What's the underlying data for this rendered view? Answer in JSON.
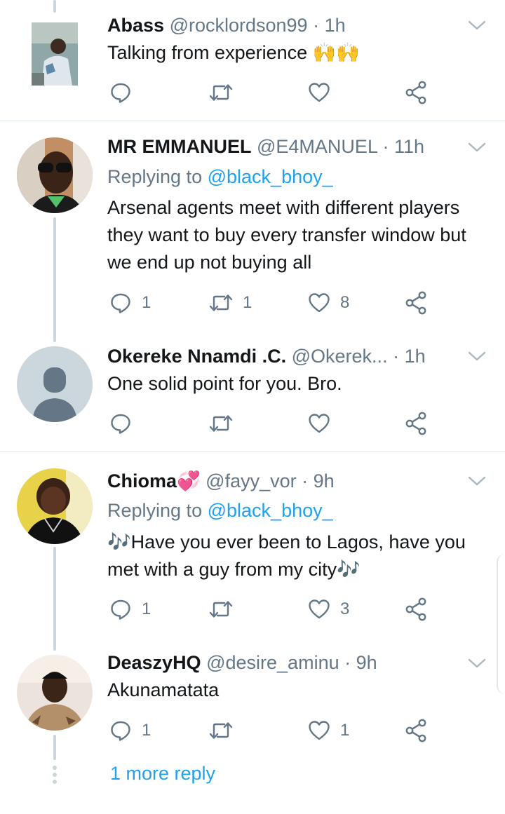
{
  "tweets": [
    {
      "name": "Abass",
      "handle": "@rocklordson99",
      "time": "1h",
      "text": "Talking from experience 🙌🙌",
      "replies": "",
      "retweets": "",
      "likes": ""
    },
    {
      "name": "MR EMMANUEL",
      "handle": "@E4MANUEL",
      "time": "11h",
      "replying_prefix": "Replying to",
      "replying_to": "@black_bhoy_",
      "text": "Arsenal agents meet with different players they want to buy every transfer window but we end up not buying all",
      "replies": "1",
      "retweets": "1",
      "likes": "8"
    },
    {
      "name": "Okereke  Nnamdi  .C.",
      "handle": "@Okerek...",
      "time": "1h",
      "text": "One solid point for you. Bro.",
      "replies": "",
      "retweets": "",
      "likes": ""
    },
    {
      "name": "Chioma💞",
      "handle": "@fayy_vor",
      "time": "9h",
      "replying_prefix": "Replying to",
      "replying_to": "@black_bhoy_",
      "text": "🎶Have you ever been to Lagos, have you met with a guy from my city🎶",
      "replies": "1",
      "retweets": "",
      "likes": "3"
    },
    {
      "name": "DeaszyHQ",
      "handle": "@desire_aminu",
      "time": "9h",
      "text": "Akunamatata",
      "replies": "1",
      "retweets": "",
      "likes": "1"
    }
  ],
  "separator_dot": "·",
  "more_replies": "1 more reply",
  "icons": {
    "reply": "reply-icon",
    "retweet": "retweet-icon",
    "like": "heart-icon",
    "share": "share-icon",
    "menu": "chevron-down-icon"
  },
  "colors": {
    "link": "#1da1f2",
    "secondary": "#657786",
    "thread_line": "#ccd6dd",
    "divider": "#e1e8ed"
  }
}
